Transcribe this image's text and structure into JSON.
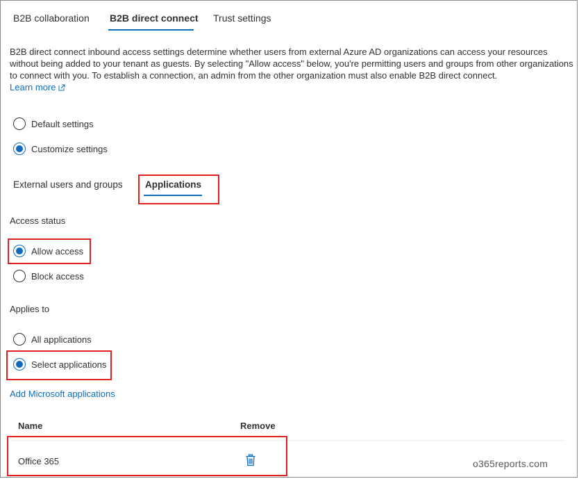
{
  "tabs": {
    "collaboration": "B2B collaboration",
    "direct_connect": "B2B direct connect",
    "trust": "Trust settings"
  },
  "description": "B2B direct connect inbound access settings determine whether users from external Azure AD organizations can access your resources without being added to your tenant as guests. By selecting \"Allow access\" below, you're permitting users and groups from other organizations to connect with you. To establish a connection, an admin from the other organization must also enable B2B direct connect.",
  "learn_more": "Learn more",
  "settings": {
    "default": "Default settings",
    "customize": "Customize settings"
  },
  "subtabs": {
    "users": "External users and groups",
    "apps": "Applications"
  },
  "access_status": {
    "label": "Access status",
    "allow": "Allow access",
    "block": "Block access"
  },
  "applies_to": {
    "label": "Applies to",
    "all": "All applications",
    "select": "Select applications"
  },
  "add_link": "Add Microsoft applications",
  "table": {
    "col_name": "Name",
    "col_remove": "Remove",
    "rows": [
      {
        "name": "Office 365"
      }
    ]
  },
  "watermark": "o365reports.com",
  "colors": {
    "accent": "#0f6cbd",
    "highlight": "#e02020"
  }
}
